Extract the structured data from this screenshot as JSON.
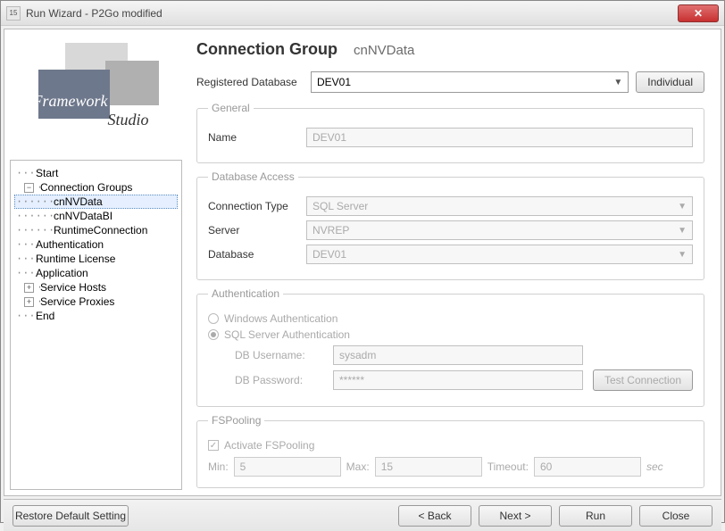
{
  "window": {
    "icon_text": "15",
    "title": "Run Wizard - P2Go modified",
    "close_glyph": "✕"
  },
  "logo": {
    "line1": "Framework",
    "line2": "Studio"
  },
  "tree": {
    "items": [
      {
        "label": "Start",
        "depth": 0,
        "expander": ""
      },
      {
        "label": "Connection Groups",
        "depth": 0,
        "expander": "−"
      },
      {
        "label": "cnNVData",
        "depth": 1,
        "expander": "",
        "selected": true
      },
      {
        "label": "cnNVDataBI",
        "depth": 1,
        "expander": ""
      },
      {
        "label": "RuntimeConnection",
        "depth": 1,
        "expander": ""
      },
      {
        "label": "Authentication",
        "depth": 0,
        "expander": ""
      },
      {
        "label": "Runtime License",
        "depth": 0,
        "expander": ""
      },
      {
        "label": "Application",
        "depth": 0,
        "expander": ""
      },
      {
        "label": "Service Hosts",
        "depth": 0,
        "expander": "+"
      },
      {
        "label": "Service Proxies",
        "depth": 0,
        "expander": "+"
      },
      {
        "label": "End",
        "depth": 0,
        "expander": ""
      }
    ]
  },
  "page": {
    "title": "Connection Group",
    "subtitle": "cnNVData",
    "registered_label": "Registered Database",
    "registered_value": "DEV01",
    "individual_btn": "Individual"
  },
  "general": {
    "legend": "General",
    "name_label": "Name",
    "name_value": "DEV01"
  },
  "db_access": {
    "legend": "Database Access",
    "conn_type_label": "Connection Type",
    "conn_type_value": "SQL Server",
    "server_label": "Server",
    "server_value": "NVREP",
    "database_label": "Database",
    "database_value": "DEV01"
  },
  "auth": {
    "legend": "Authentication",
    "windows_auth": "Windows Authentication",
    "sql_auth": "SQL Server Authentication",
    "db_user_label": "DB Username:",
    "db_user_value": "sysadm",
    "db_pass_label": "DB Password:",
    "db_pass_value": "******",
    "test_btn": "Test Connection"
  },
  "pooling": {
    "legend": "FSPooling",
    "activate_label": "Activate FSPooling",
    "min_label": "Min:",
    "min_value": "5",
    "max_label": "Max:",
    "max_value": "15",
    "timeout_label": "Timeout:",
    "timeout_value": "60",
    "sec_label": "sec"
  },
  "footer": {
    "restore": "Restore Default Setting",
    "back": "< Back",
    "next": "Next >",
    "run": "Run",
    "close": "Close"
  }
}
